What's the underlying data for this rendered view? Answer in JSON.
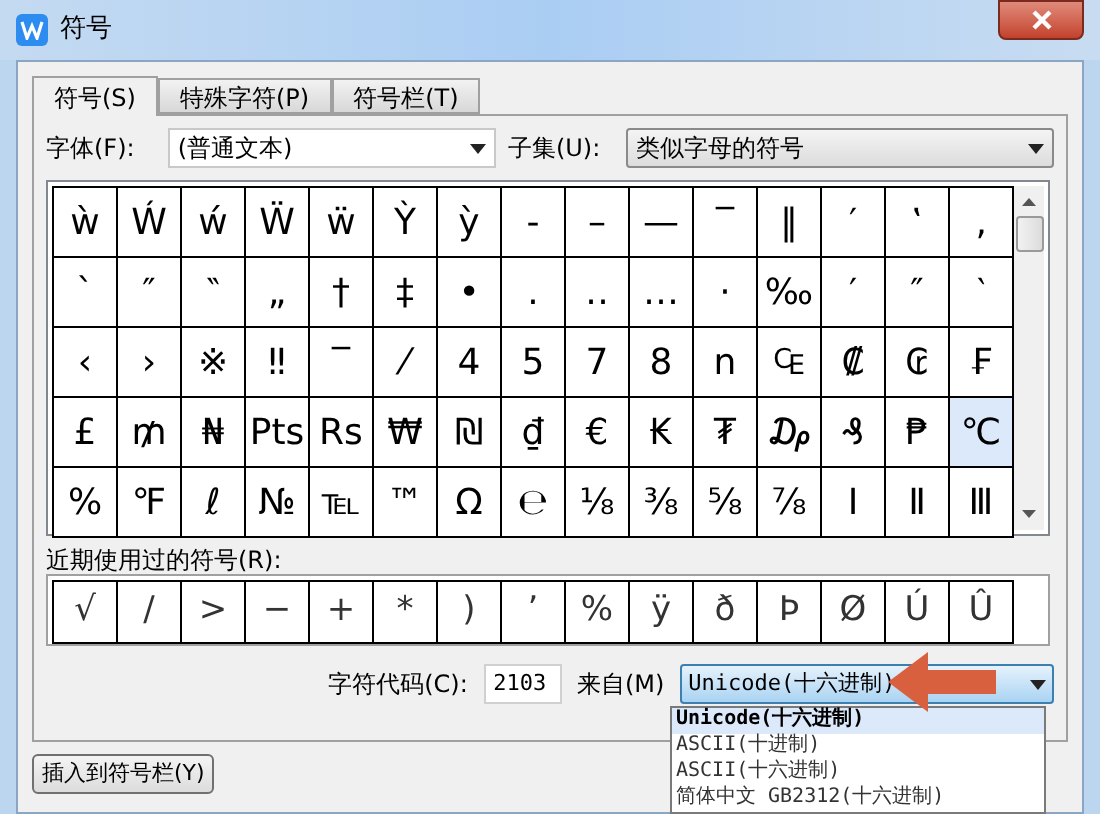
{
  "window": {
    "title": "符号"
  },
  "tabs": [
    {
      "label": "符号(S)",
      "selected": true
    },
    {
      "label": "特殊字符(P)",
      "selected": false
    },
    {
      "label": "符号栏(T)",
      "selected": false
    }
  ],
  "font": {
    "label": "字体(F):",
    "value": "(普通文本)"
  },
  "subset": {
    "label": "子集(U):",
    "value": "类似字母的符号"
  },
  "symbols": [
    {
      "char": "ẁ",
      "selected": false
    },
    {
      "char": "Ẃ",
      "selected": false
    },
    {
      "char": "ẃ",
      "selected": false
    },
    {
      "char": "Ẅ",
      "selected": false
    },
    {
      "char": "ẅ",
      "selected": false
    },
    {
      "char": "Ỳ",
      "selected": false
    },
    {
      "char": "ỳ",
      "selected": false
    },
    {
      "char": "‐",
      "selected": false
    },
    {
      "char": "–",
      "selected": false
    },
    {
      "char": "—",
      "selected": false
    },
    {
      "char": "‾",
      "selected": false
    },
    {
      "char": "‖",
      "selected": false
    },
    {
      "char": "′",
      "selected": false
    },
    {
      "char": "‛",
      "selected": false
    },
    {
      "char": "‚",
      "selected": false
    },
    {
      "char": "`",
      "selected": false
    },
    {
      "char": "″",
      "selected": false
    },
    {
      "char": "‶",
      "selected": false
    },
    {
      "char": "„",
      "selected": false
    },
    {
      "char": "†",
      "selected": false
    },
    {
      "char": "‡",
      "selected": false
    },
    {
      "char": "•",
      "selected": false
    },
    {
      "char": ".",
      "selected": false
    },
    {
      "char": "‥",
      "selected": false
    },
    {
      "char": "…",
      "selected": false
    },
    {
      "char": "·",
      "selected": false
    },
    {
      "char": "‰",
      "selected": false
    },
    {
      "char": "′",
      "selected": false
    },
    {
      "char": "″",
      "selected": false
    },
    {
      "char": "‵",
      "selected": false
    },
    {
      "char": "‹",
      "selected": false
    },
    {
      "char": "›",
      "selected": false
    },
    {
      "char": "※",
      "selected": false
    },
    {
      "char": "‼",
      "selected": false
    },
    {
      "char": "‾",
      "selected": false
    },
    {
      "char": "⁄",
      "selected": false
    },
    {
      "char": "4",
      "selected": false
    },
    {
      "char": "5",
      "selected": false
    },
    {
      "char": "7",
      "selected": false
    },
    {
      "char": "8",
      "selected": false
    },
    {
      "char": "n",
      "selected": false
    },
    {
      "char": "₠",
      "selected": false
    },
    {
      "char": "₡",
      "selected": false
    },
    {
      "char": "₢",
      "selected": false
    },
    {
      "char": "₣",
      "selected": false
    },
    {
      "char": "£",
      "selected": false
    },
    {
      "char": "₥",
      "selected": false
    },
    {
      "char": "₦",
      "selected": false
    },
    {
      "char": "Pts",
      "selected": false
    },
    {
      "char": "Rs",
      "selected": false
    },
    {
      "char": "₩",
      "selected": false
    },
    {
      "char": "₪",
      "selected": false
    },
    {
      "char": "₫",
      "selected": false
    },
    {
      "char": "€",
      "selected": false
    },
    {
      "char": "₭",
      "selected": false
    },
    {
      "char": "₮",
      "selected": false
    },
    {
      "char": "₯",
      "selected": false
    },
    {
      "char": "₰",
      "selected": false
    },
    {
      "char": "₱",
      "selected": false
    },
    {
      "char": "℃",
      "selected": true
    },
    {
      "char": "%",
      "selected": false
    },
    {
      "char": "℉",
      "selected": false
    },
    {
      "char": "ℓ",
      "selected": false
    },
    {
      "char": "№",
      "selected": false
    },
    {
      "char": "℡",
      "selected": false
    },
    {
      "char": "™",
      "selected": false
    },
    {
      "char": "Ω",
      "selected": false
    },
    {
      "char": "℮",
      "selected": false
    },
    {
      "char": "⅛",
      "selected": false
    },
    {
      "char": "⅜",
      "selected": false
    },
    {
      "char": "⅝",
      "selected": false
    },
    {
      "char": "⅞",
      "selected": false
    },
    {
      "char": "Ⅰ",
      "selected": false
    },
    {
      "char": "Ⅱ",
      "selected": false
    },
    {
      "char": "Ⅲ",
      "selected": false
    }
  ],
  "recent": {
    "label": "近期使用过的符号(R):",
    "symbols": [
      "√",
      "/",
      ">",
      "−",
      "+",
      "*",
      ")",
      "’",
      "%",
      "ÿ",
      "ð",
      "Þ",
      "Ø",
      "Ú",
      "Û"
    ]
  },
  "char_code": {
    "label": "字符代码(C):",
    "value": "2103"
  },
  "from": {
    "label": "来自(M)",
    "value": "Unicode(十六进制)",
    "options": [
      {
        "label": "Unicode(十六进制)",
        "selected": true
      },
      {
        "label": "ASCII(十进制)",
        "selected": false
      },
      {
        "label": "ASCII(十六进制)",
        "selected": false
      },
      {
        "label": "简体中文 GB2312(十六进制)",
        "selected": false
      }
    ]
  },
  "insert_button": "插入到符号栏(Y)"
}
